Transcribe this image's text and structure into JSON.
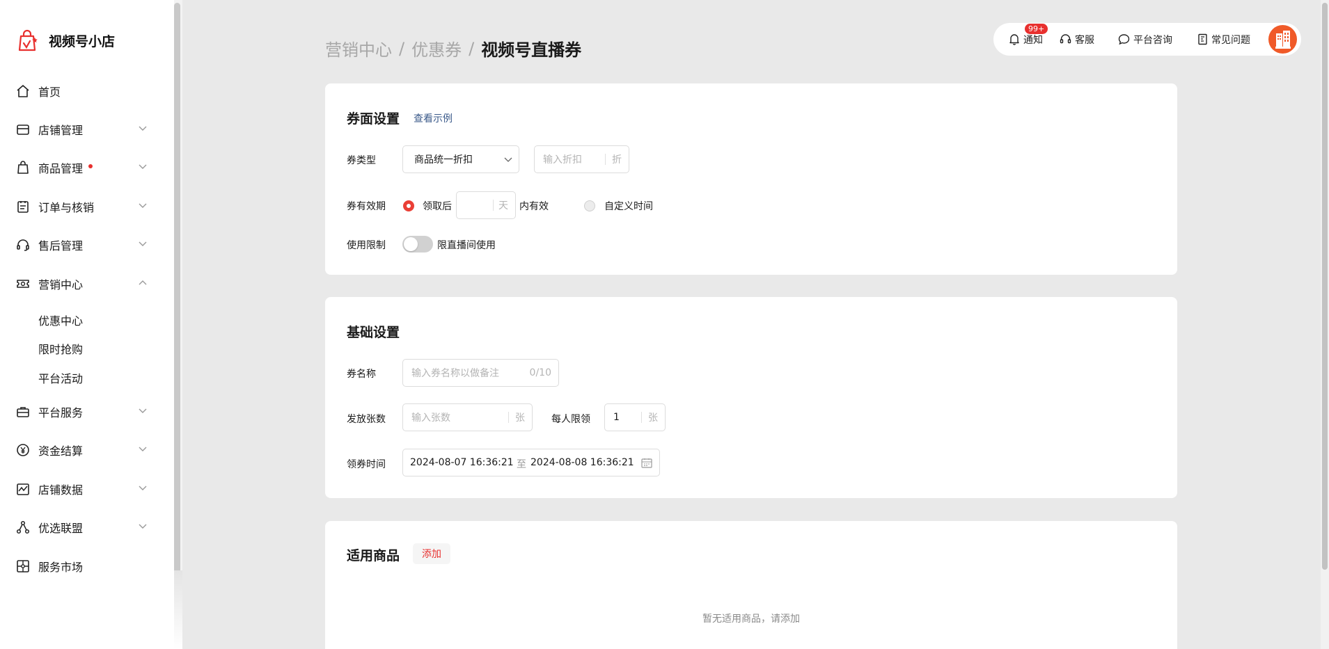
{
  "app": {
    "name": "视频号小店"
  },
  "sidebar": {
    "items": [
      {
        "label": "首页",
        "icon": "home-icon"
      },
      {
        "label": "店铺管理",
        "icon": "store-icon"
      },
      {
        "label": "商品管理",
        "icon": "shopping-bag-icon"
      },
      {
        "label": "订单与核销",
        "icon": "clipboard-icon"
      },
      {
        "label": "售后管理",
        "icon": "headset-icon"
      },
      {
        "label": "营销中心",
        "icon": "ticket-icon"
      },
      {
        "label": "平台服务",
        "icon": "briefcase-icon"
      },
      {
        "label": "资金结算",
        "icon": "yuan-icon"
      },
      {
        "label": "店铺数据",
        "icon": "chart-icon"
      },
      {
        "label": "优选联盟",
        "icon": "network-icon"
      },
      {
        "label": "服务市场",
        "icon": "puzzle-icon"
      }
    ],
    "subitems": [
      "优惠中心",
      "限时抢购",
      "平台活动"
    ]
  },
  "breadcrumb": {
    "level1": "营销中心",
    "level2": "优惠券",
    "current": "视频号直播券",
    "separator": "/"
  },
  "topbar": {
    "notify_label": "通知",
    "notify_badge": "99+",
    "service_label": "客服",
    "consult_label": "平台咨询",
    "faq_label": "常见问题"
  },
  "coupon_face": {
    "title": "券面设置",
    "example_link": "查看示例",
    "type_label": "券类型",
    "type_value": "商品统一折扣",
    "discount_placeholder": "输入折扣",
    "discount_unit": "折",
    "validity_label": "券有效期",
    "after_claim_label": "领取后",
    "days_unit": "天",
    "within_label": "内有效",
    "custom_time_label": "自定义时间",
    "limit_label": "使用限制",
    "live_only_label": "限直播间使用"
  },
  "basic": {
    "title": "基础设置",
    "name_label": "券名称",
    "name_placeholder": "输入券名称以做备注",
    "name_counter": "0/10",
    "qty_label": "发放张数",
    "qty_placeholder": "输入张数",
    "qty_unit": "张",
    "per_user_label": "每人限领",
    "per_user_value": "1",
    "per_user_unit": "张",
    "time_label": "领券时间",
    "start_time": "2024-08-07 16:36:21",
    "to_label": "至",
    "end_time": "2024-08-08 16:36:21"
  },
  "products": {
    "title": "适用商品",
    "add_label": "添加",
    "empty_text": "暂无适用商品，请添加"
  },
  "colors": {
    "accent": "#e8302e",
    "link": "#3b5a8a",
    "background": "#e9e9e9"
  }
}
